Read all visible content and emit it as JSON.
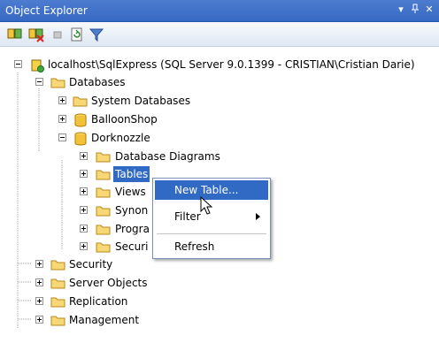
{
  "window": {
    "title": "Object Explorer",
    "controls": [
      "chevron-down-icon",
      "pin-icon",
      "close-icon"
    ],
    "accent": "#3a6fc7"
  },
  "toolbar": {
    "buttons": [
      "connect-icon",
      "disconnect-icon",
      "stop-icon",
      "refresh-icon",
      "filter-icon"
    ]
  },
  "tree": {
    "root": "localhost\\SqlExpress (SQL Server 9.0.1399 - CRISTIAN\\Cristian Darie)",
    "databases": "Databases",
    "system_databases": "System Databases",
    "balloonshop": "BalloonShop",
    "dorknozzle": "Dorknozzle",
    "db_diagrams": "Database Diagrams",
    "tables": "Tables",
    "views": "Views",
    "synonyms": "Synon",
    "programmability": "Progra",
    "db_security": "Securi",
    "security": "Security",
    "server_objects": "Server Objects",
    "replication": "Replication",
    "management": "Management"
  },
  "context_menu": {
    "new_table": "New Table...",
    "filter": "Filter",
    "refresh": "Refresh",
    "selection_color": "#316ac5"
  }
}
